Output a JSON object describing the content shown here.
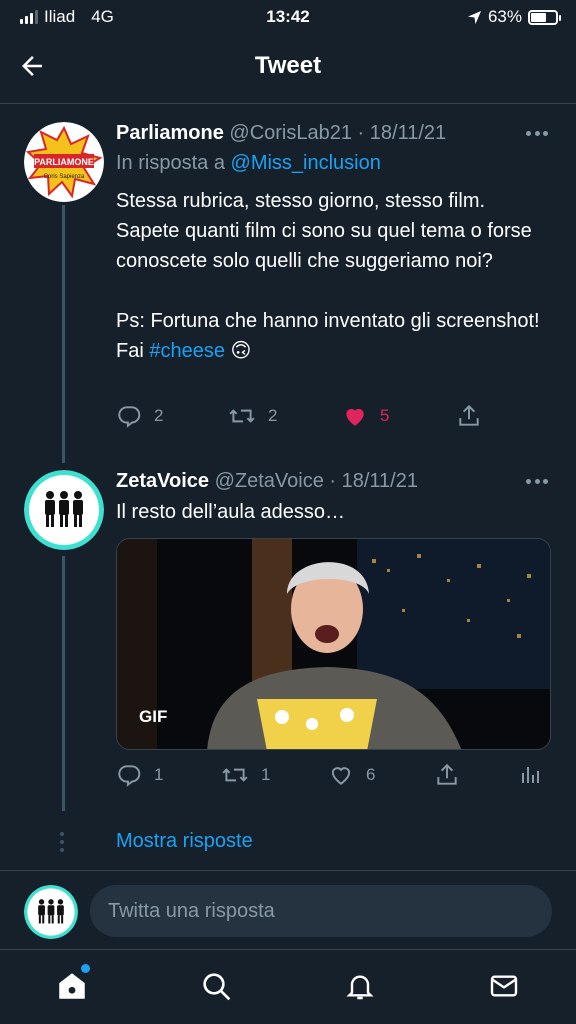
{
  "status_bar": {
    "carrier": "Iliad",
    "network": "4G",
    "time": "13:42",
    "battery": "63%",
    "battery_level": 0.63
  },
  "header": {
    "title": "Tweet"
  },
  "tweet1": {
    "name": "Parliamone",
    "handle": "@CorisLab21",
    "date": "· 18/11/21",
    "reply_prefix": "In risposta a ",
    "reply_to": "@Miss_inclusion",
    "text_main": "Stessa rubrica, stesso giorno, stesso film.\nSapete quanti film ci sono su quel tema o forse conoscete solo quelli che suggeriamo noi?\n\nPs: Fortuna che hanno inventato gli screenshot! Fai ",
    "hashtag": "#cheese",
    "emoji": " 🙃",
    "avatar_lines": [
      "PARLIAMONE",
      "Coris Sapienza"
    ],
    "replies": "2",
    "retweets": "2",
    "likes": "5"
  },
  "tweet2": {
    "name": "ZetaVoice",
    "handle": "@ZetaVoice",
    "date": "· 18/11/21",
    "text": "Il resto dell’aula adesso…",
    "gif_label": "GIF",
    "replies": "1",
    "retweets": "1",
    "likes": "6"
  },
  "show_replies": "Mostra risposte",
  "composer": {
    "placeholder": "Twitta una risposta"
  },
  "colors": {
    "accent": "#1da1f2",
    "like": "#e0245e",
    "background": "#15202b",
    "muted": "#8899a6"
  },
  "icons": [
    "back-arrow-icon",
    "reply-icon",
    "retweet-icon",
    "heart-icon",
    "share-icon",
    "analytics-icon",
    "home-icon",
    "search-icon",
    "bell-icon",
    "mail-icon"
  ]
}
